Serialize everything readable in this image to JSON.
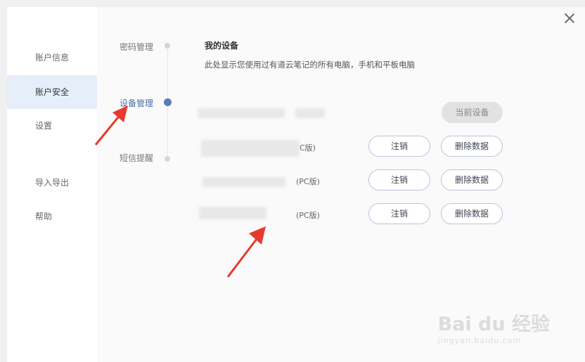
{
  "sidebar": {
    "items": [
      {
        "label": "账户信息",
        "active": false
      },
      {
        "label": "账户安全",
        "active": true
      },
      {
        "label": "设置",
        "active": false
      },
      {
        "label": "导入导出",
        "active": false
      },
      {
        "label": "帮助",
        "active": false
      }
    ]
  },
  "subnav": {
    "items": [
      {
        "label": "密码管理"
      },
      {
        "label": "设备管理"
      },
      {
        "label": "短信提醒"
      }
    ]
  },
  "content": {
    "title": "我的设备",
    "description": "此处显示您使用过有道云笔记的所有电脑，手机和平板电脑",
    "devices": [
      {
        "suffix": "",
        "current_label": "当前设备"
      },
      {
        "suffix": "C版)",
        "logout_label": "注销",
        "delete_label": "删除数据"
      },
      {
        "suffix": "(PC版)",
        "logout_label": "注销",
        "delete_label": "删除数据"
      },
      {
        "suffix": "(PC版)",
        "logout_label": "注销",
        "delete_label": "删除数据"
      }
    ]
  },
  "watermark": {
    "text": "Bai du 经验",
    "sub": "jingyan.baidu.com"
  },
  "colors": {
    "accent": "#5b7bb4",
    "annotation_arrow": "#e8392e",
    "active_sidebar_bg": "#e6eef9"
  }
}
